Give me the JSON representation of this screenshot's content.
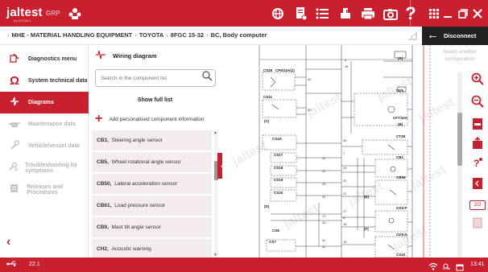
{
  "app": {
    "logo": "jaltest",
    "logo_suffix": "GRP",
    "logo_tagline": "by COJALI"
  },
  "topbar": {
    "icons": [
      "gear-globe-icon",
      "document-icon",
      "list-icon",
      "print-report-icon",
      "printer-icon",
      "camera-icon",
      "help-icon",
      "apps-grid-icon",
      "minimize-icon",
      "maximize-icon",
      "close-icon"
    ],
    "help_glyph": "?"
  },
  "breadcrumb": {
    "items": [
      "MHE - MATERIAL HANDLING EQUIPMENT",
      "TOYOTA",
      "8FGC 15-32",
      "BC, Body computer"
    ]
  },
  "disconnect_label": "Disconnect",
  "select_another_configuration": "Select another configuration",
  "sidebar": {
    "items": [
      {
        "label": "Diagnostics menu",
        "icon": "diagnostics-icon",
        "state": "normal"
      },
      {
        "label": "System technical data",
        "icon": "ohm-icon",
        "state": "normal"
      },
      {
        "label": "Diagrams",
        "icon": "diagram-icon",
        "state": "active"
      },
      {
        "label": "Maintenance data",
        "icon": "oil-can-icon",
        "state": "dim"
      },
      {
        "label": "Vehicle/vessel data",
        "icon": "wrench-icon",
        "state": "dim"
      },
      {
        "label": "Troubleshooting by symptoms",
        "icon": "troubleshooting-icon",
        "state": "dim"
      },
      {
        "label": "Releases and Procedures",
        "icon": "procedures-icon",
        "state": "dim"
      }
    ]
  },
  "panel": {
    "title": "Wiring diagram",
    "search_placeholder": "Search in the component list",
    "show_full_list": "Show full list",
    "add_component": "Add personalised component information",
    "components": [
      {
        "code": "CB3,",
        "name": "Steering angle sensor"
      },
      {
        "code": "CB5,",
        "name": "Wheel rotational angle sensor"
      },
      {
        "code": "CB50,",
        "name": "Lateral acceleration sensor"
      },
      {
        "code": "CB61,",
        "name": "Load pressure sensor"
      },
      {
        "code": "CB9,",
        "name": "Mast tilt angle sensor"
      },
      {
        "code": "CH2,",
        "name": "Acoustic warning"
      }
    ]
  },
  "diagram": {
    "labels": [
      "CS26",
      "CP6/10A(2)",
      "CS11",
      "CS4A",
      "CS17",
      "CS18",
      "CS19",
      "CS20",
      "CS8",
      "CS7",
      "CK5",
      "CF7/10A",
      "CT28",
      "CB1",
      "CB56",
      "CK5-P",
      "CK5-N",
      "CX41",
      "(A)",
      "(B)",
      "(C)",
      "(D)",
      "(E)",
      "(F)"
    ],
    "watermark": "jaltest"
  },
  "rightbar": {
    "tools": [
      "zoom-in-icon",
      "zoom-out-icon",
      "pdf-icon",
      "share-icon",
      "notes-icon",
      "bookmark-icon",
      "page-icon"
    ],
    "page_indicator": "2/2"
  },
  "statusbar": {
    "version": "22.1",
    "wifi": "100%",
    "time": "13:41"
  },
  "colors": {
    "brand": "#c8202f",
    "sidebar_active": "#c8202f",
    "list_row_bg": "#f5eded",
    "disconnect_bg": "#222222"
  }
}
